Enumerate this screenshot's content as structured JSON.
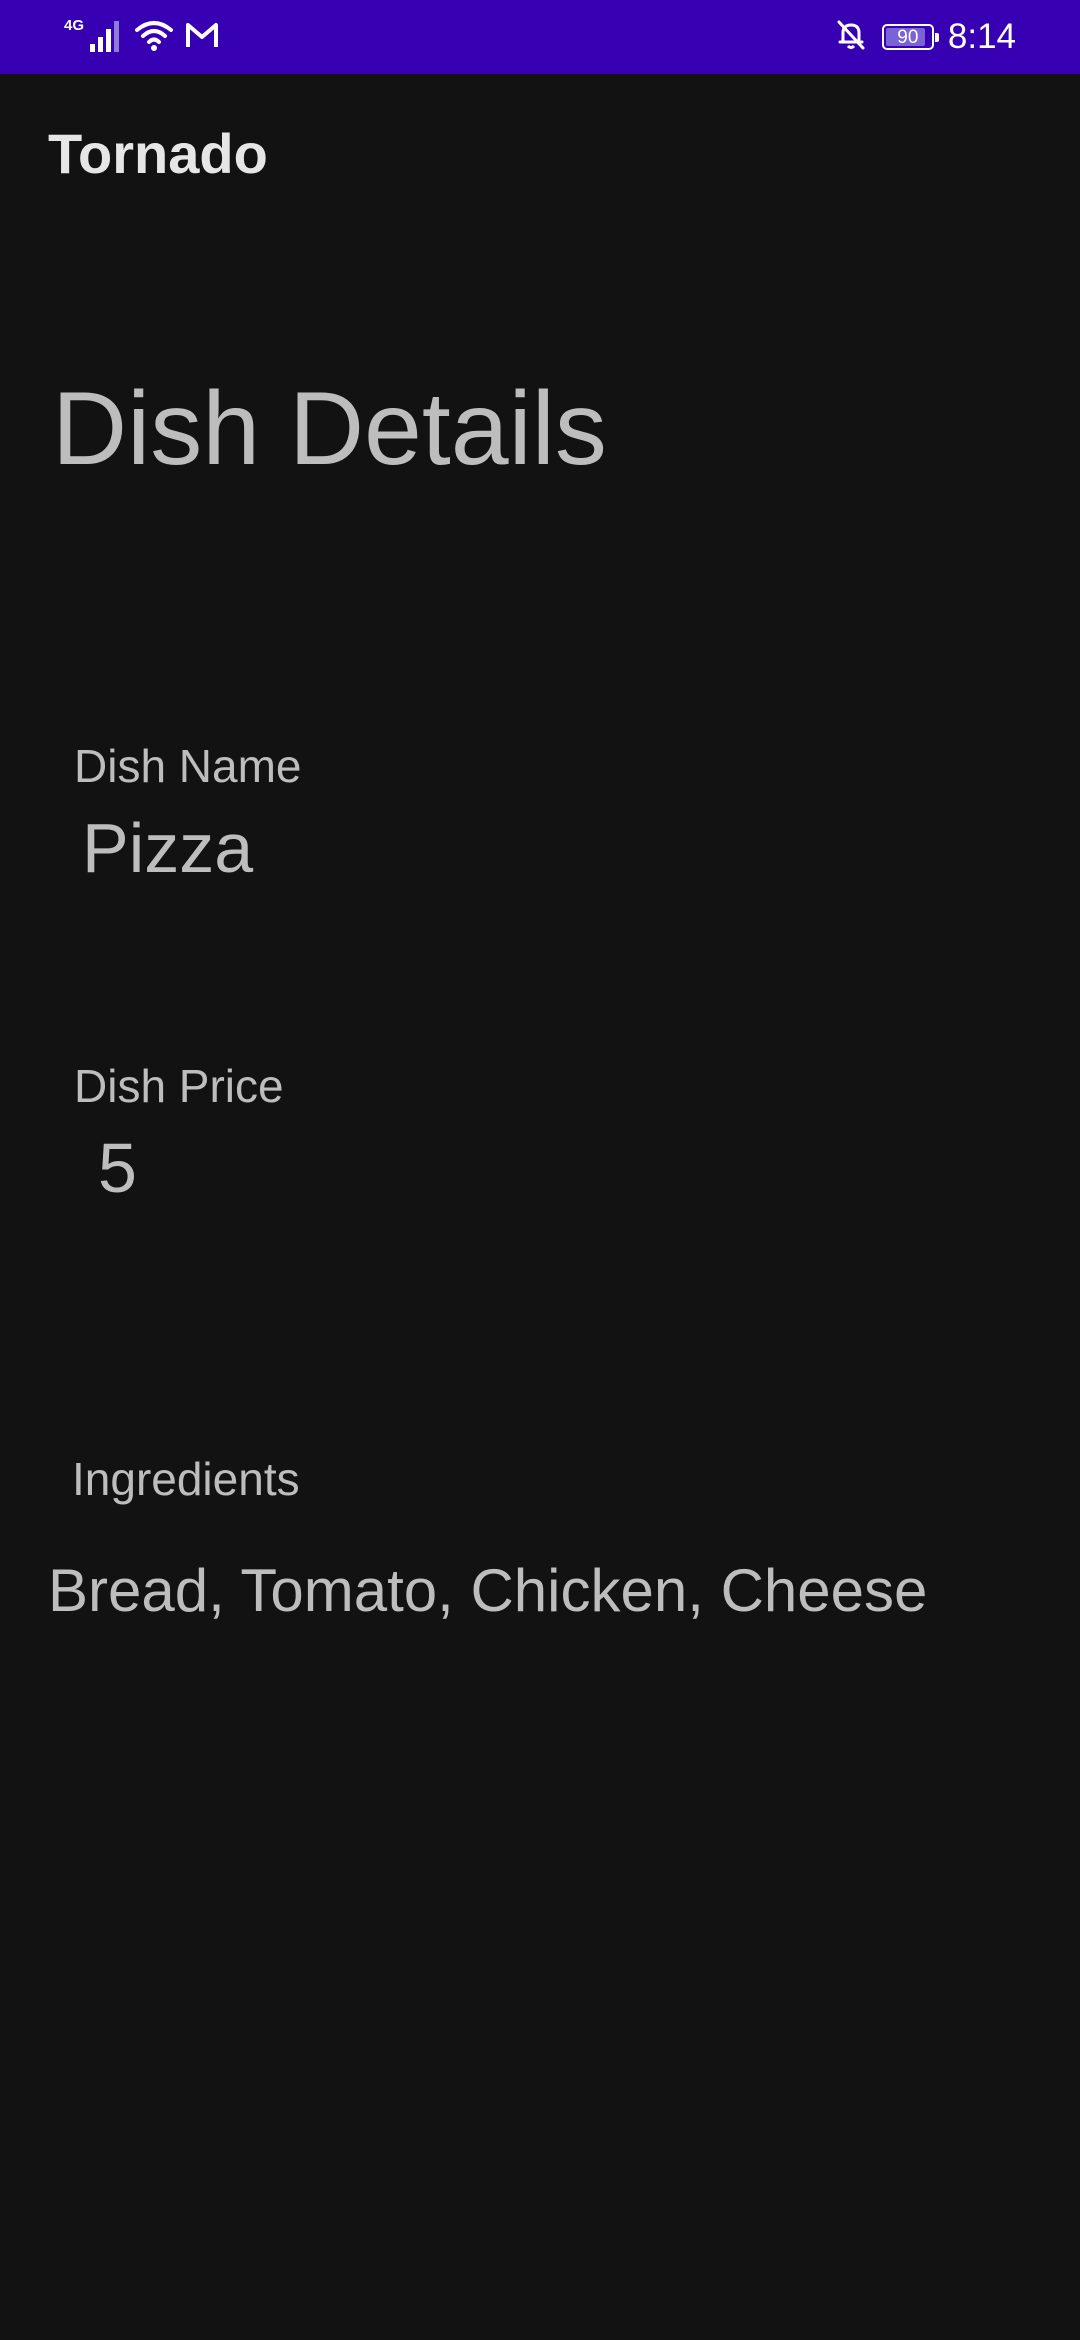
{
  "status_bar": {
    "network_type": "4G",
    "battery_level": 90,
    "battery_text": "90",
    "time": "8:14",
    "background_color": "#3700b3",
    "icons": [
      "signal-icon",
      "wifi-icon",
      "gmail-icon",
      "notifications-off-icon",
      "battery-icon"
    ]
  },
  "app_bar": {
    "title": "Tornado"
  },
  "page": {
    "title": "Dish Details"
  },
  "dish": {
    "name_label": "Dish Name",
    "name": "Pizza",
    "price_label": "Dish Price",
    "price": "5",
    "ingredients_label": "Ingredients",
    "ingredients": "Bread, Tomato, Chicken, Cheese"
  },
  "colors": {
    "background": "#121212",
    "text": "#bdbdbd",
    "status_bar": "#3700b3"
  }
}
